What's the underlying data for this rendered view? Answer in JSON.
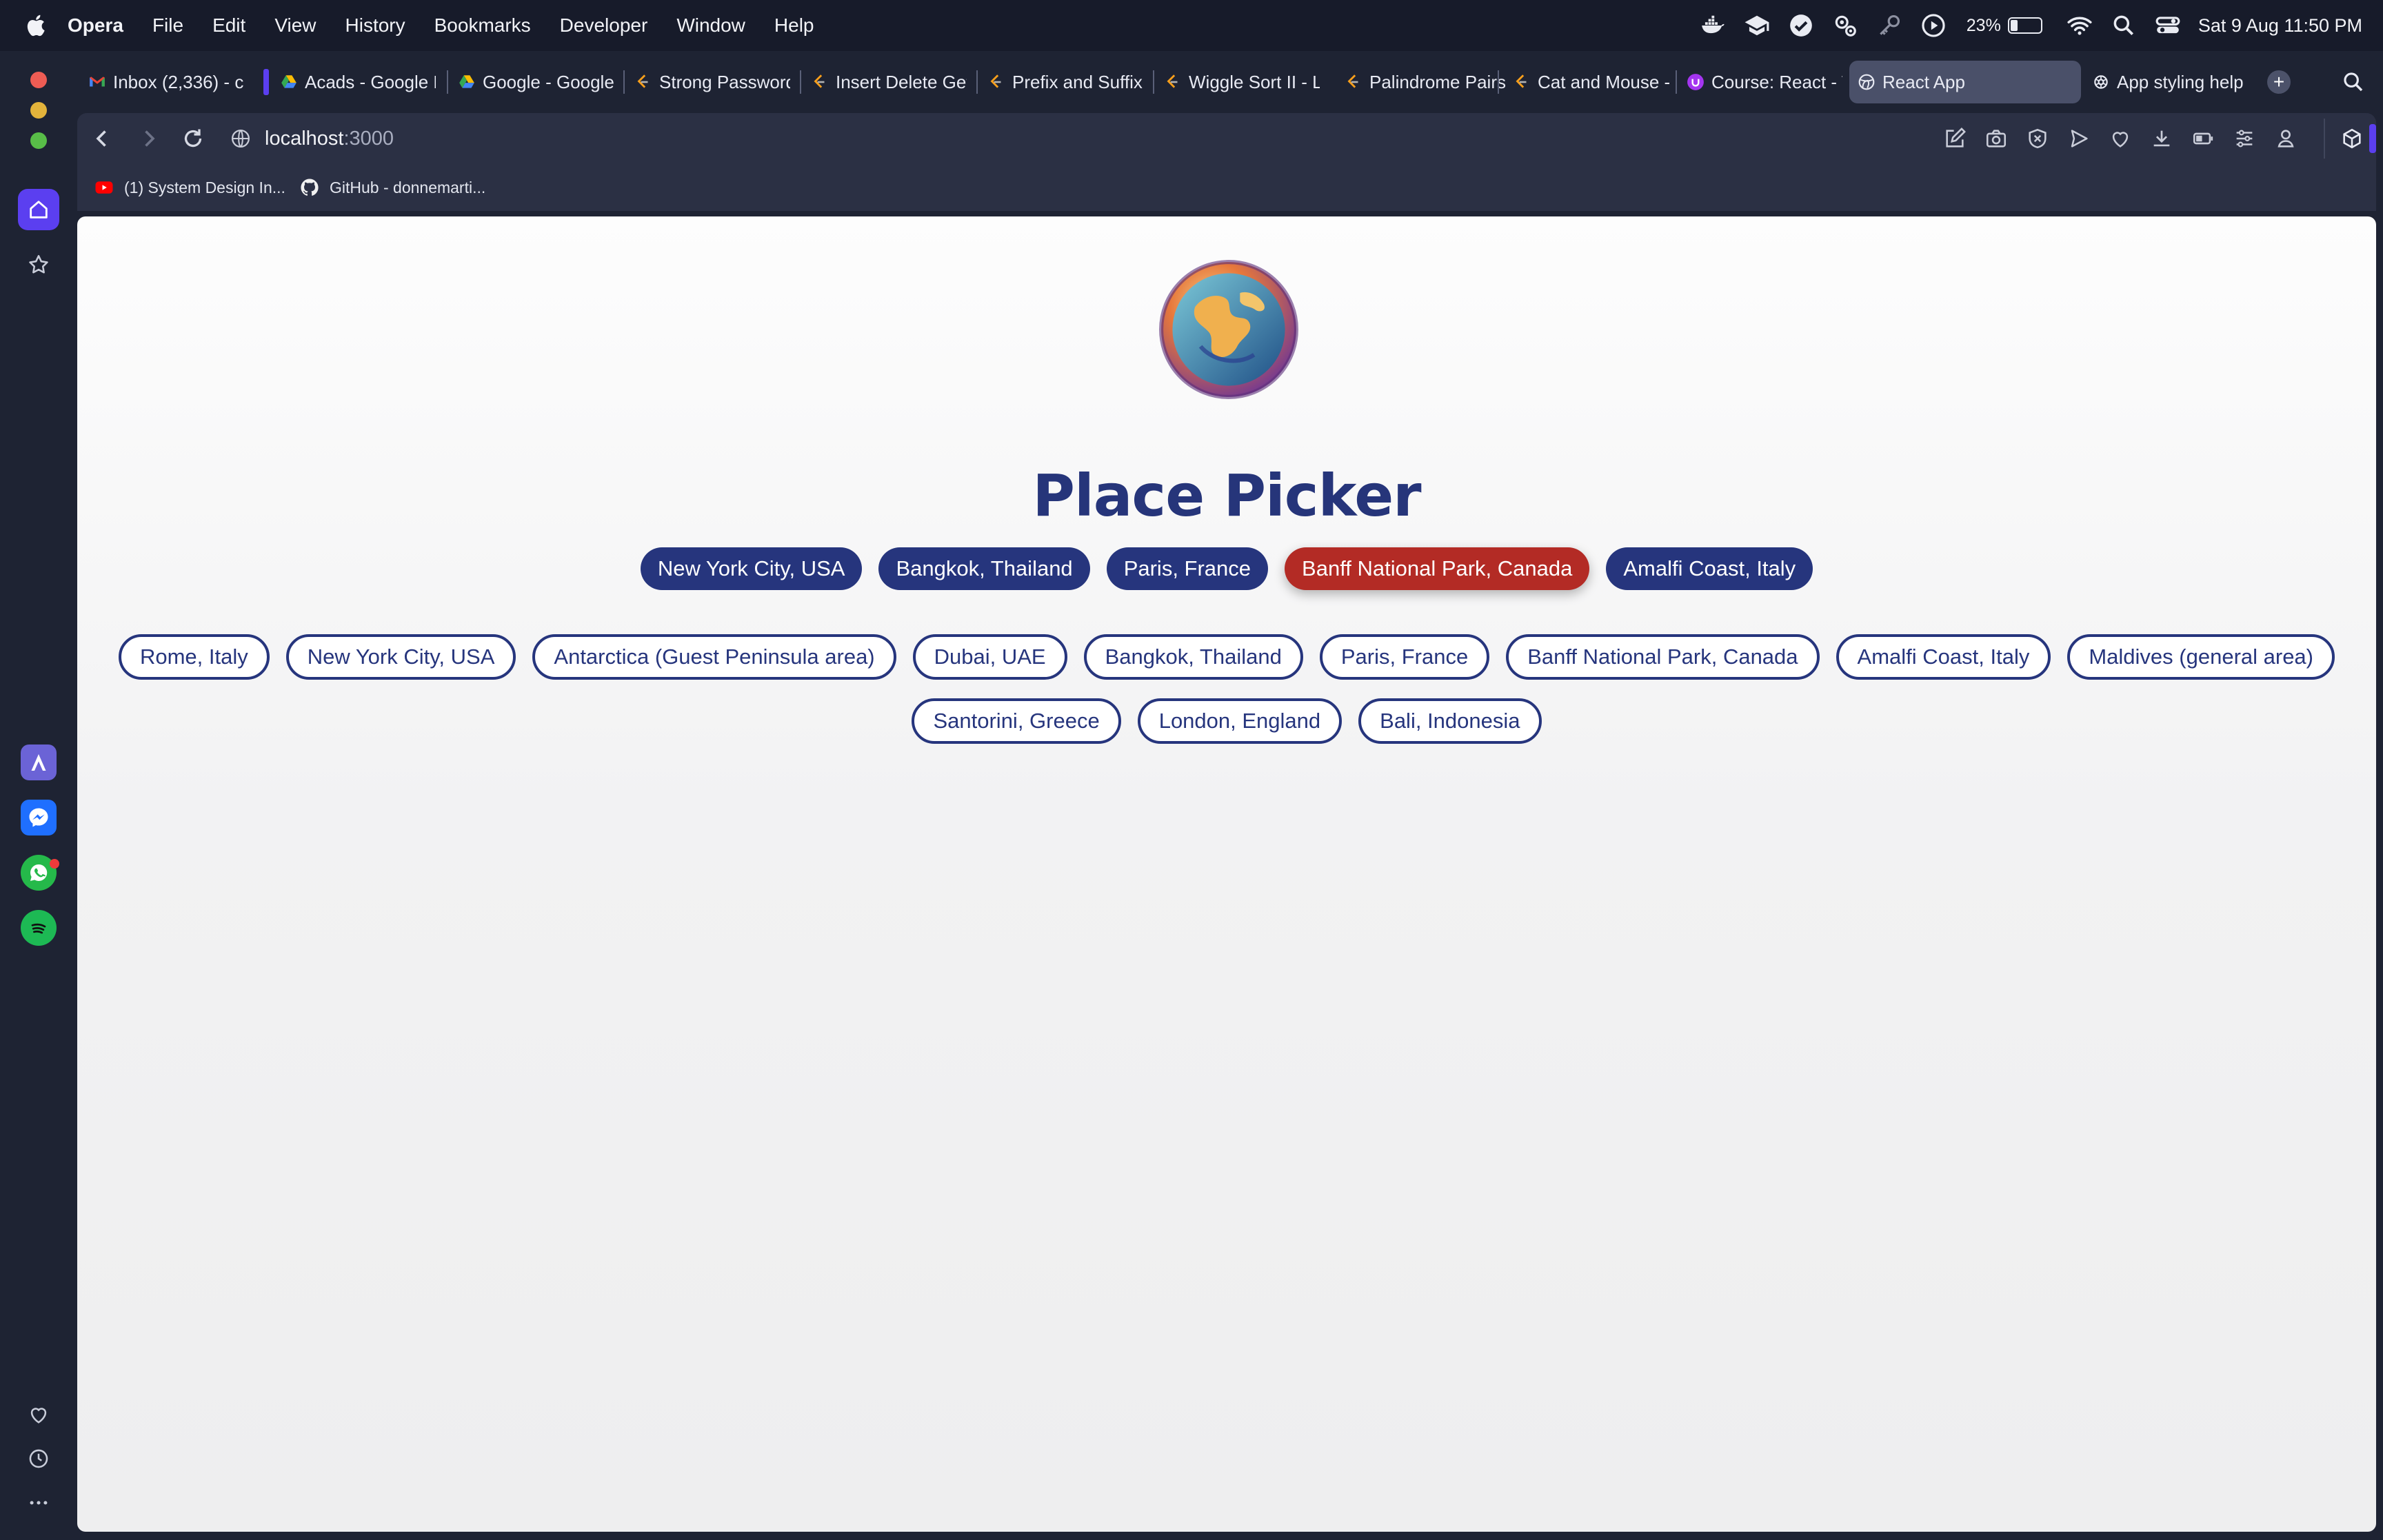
{
  "menubar": {
    "app_name": "Opera",
    "items": [
      "File",
      "Edit",
      "View",
      "History",
      "Bookmarks",
      "Developer",
      "Window",
      "Help"
    ],
    "battery_percent": "23%",
    "battery_level": 0.23,
    "datetime": "Sat 9 Aug  11:50 PM"
  },
  "tabs": [
    {
      "label": "Inbox (2,336) - c",
      "icon": "gmail-icon"
    },
    {
      "label": "Acads - Google D",
      "icon": "google-drive-icon"
    },
    {
      "label": "Google - Google",
      "icon": "google-drive-icon"
    },
    {
      "label": "Strong Password",
      "icon": "leetcode-icon"
    },
    {
      "label": "Insert Delete Get",
      "icon": "leetcode-icon"
    },
    {
      "label": "Prefix and Suffix",
      "icon": "leetcode-icon"
    },
    {
      "label": "Wiggle Sort II - L",
      "icon": "leetcode-icon"
    },
    {
      "label": "Palindrome Pairs",
      "icon": "leetcode-icon"
    },
    {
      "label": "Cat and Mouse -",
      "icon": "leetcode-icon"
    },
    {
      "label": "Course: React - T",
      "icon": "udemy-icon"
    },
    {
      "label": "React App",
      "icon": "globe-icon"
    },
    {
      "label": "App styling help",
      "icon": "chatgpt-icon"
    }
  ],
  "address": {
    "host": "localhost",
    "port": ":3000"
  },
  "bookmarks": [
    {
      "label": "(1) System Design In...",
      "icon": "youtube-icon"
    },
    {
      "label": "GitHub - donnemarti...",
      "icon": "github-icon"
    }
  ],
  "page": {
    "title": "Place Picker",
    "selected_places": [
      {
        "label": "New York City, USA",
        "highlight": false
      },
      {
        "label": "Bangkok, Thailand",
        "highlight": false
      },
      {
        "label": "Paris, France",
        "highlight": false
      },
      {
        "label": "Banff National Park, Canada",
        "highlight": true
      },
      {
        "label": "Amalfi Coast, Italy",
        "highlight": false
      }
    ],
    "available_places_row1": [
      "Rome, Italy",
      "New York City, USA",
      "Antarctica (Guest Peninsula area)",
      "Dubai, UAE",
      "Bangkok, Thailand",
      "Paris, France",
      "Banff National Park, Canada",
      "Amalfi Coast, Italy",
      "Maldives (general area)"
    ],
    "available_places_row2": [
      "Santorini, Greece",
      "London, England",
      "Bali, Indonesia"
    ]
  },
  "colors": {
    "primary": "#26357d",
    "highlight": "#b32b25",
    "accent": "#5b3ff0"
  }
}
